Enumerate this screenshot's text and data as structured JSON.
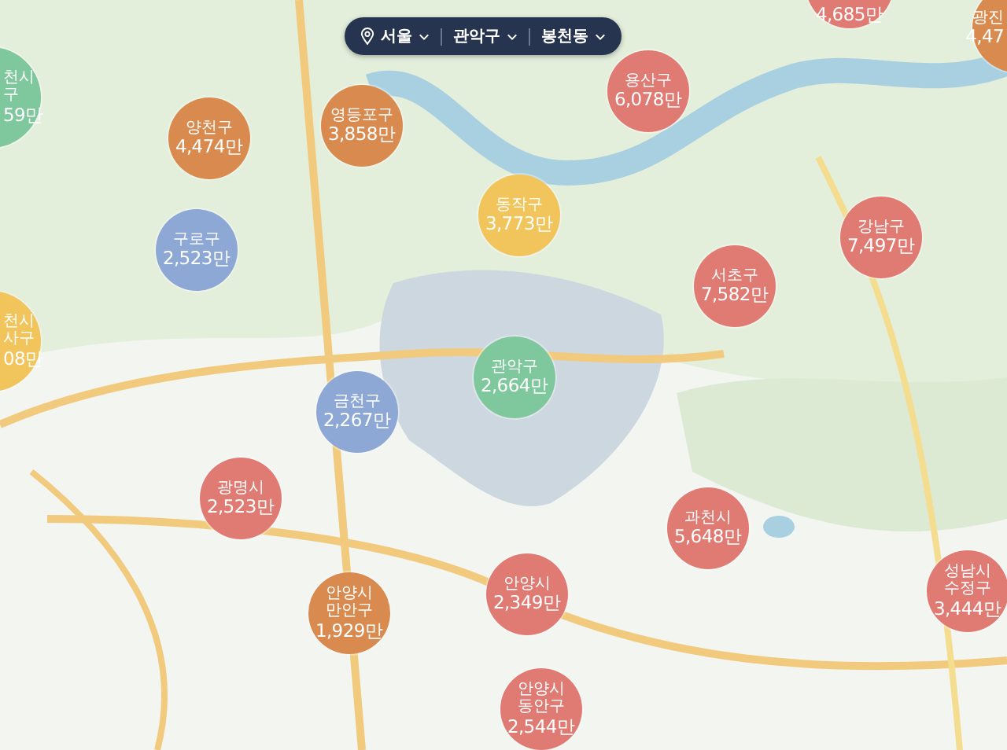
{
  "location_bar": {
    "items": [
      {
        "label": "서울",
        "kind": "region"
      },
      {
        "label": "관악구",
        "kind": "district"
      },
      {
        "label": "봉천동",
        "kind": "district"
      }
    ]
  },
  "markers": [
    {
      "name_lines": [
        "천시",
        "구"
      ],
      "price": "59만",
      "color": "#7fc79d"
    },
    {
      "name_lines": [
        "천시",
        "사구"
      ],
      "price": "08만",
      "color": "#f2c55c"
    },
    {
      "price": "4,685만",
      "color": "#e07b74"
    },
    {
      "name_lines": [
        "광진"
      ],
      "price": "4,47",
      "color": "#d98a4f"
    },
    {
      "name_lines": [
        "양천구"
      ],
      "price": "4,474만",
      "color": "#d98a4f"
    },
    {
      "name_lines": [
        "영등포구"
      ],
      "price": "3,858만",
      "color": "#d98a4f"
    },
    {
      "name_lines": [
        "용산구"
      ],
      "price": "6,078만",
      "color": "#e07b74"
    },
    {
      "name_lines": [
        "동작구"
      ],
      "price": "3,773만",
      "color": "#f2c55c"
    },
    {
      "name_lines": [
        "구로구"
      ],
      "price": "2,523만",
      "color": "#8ea8d6"
    },
    {
      "name_lines": [
        "서초구"
      ],
      "price": "7,582만",
      "color": "#e07b74"
    },
    {
      "name_lines": [
        "강남구"
      ],
      "price": "7,497만",
      "color": "#e07b74"
    },
    {
      "name_lines": [
        "관악구"
      ],
      "price": "2,664만",
      "color": "#7fc79d"
    },
    {
      "name_lines": [
        "금천구"
      ],
      "price": "2,267만",
      "color": "#8ea8d6"
    },
    {
      "name_lines": [
        "광명시"
      ],
      "price": "2,523만",
      "color": "#e07b74"
    },
    {
      "name_lines": [
        "과천시"
      ],
      "price": "5,648만",
      "color": "#e07b74"
    },
    {
      "name_lines": [
        "안양시"
      ],
      "price": "2,349만",
      "color": "#e07b74"
    },
    {
      "name_lines": [
        "안양시",
        "만안구"
      ],
      "price": "1,929만",
      "color": "#d98a4f"
    },
    {
      "name_lines": [
        "안양시",
        "동안구"
      ],
      "price": "2,544만",
      "color": "#e07b74"
    },
    {
      "name_lines": [
        "성남시",
        "수정구"
      ],
      "price": "3,444만",
      "color": "#e07b74"
    }
  ]
}
